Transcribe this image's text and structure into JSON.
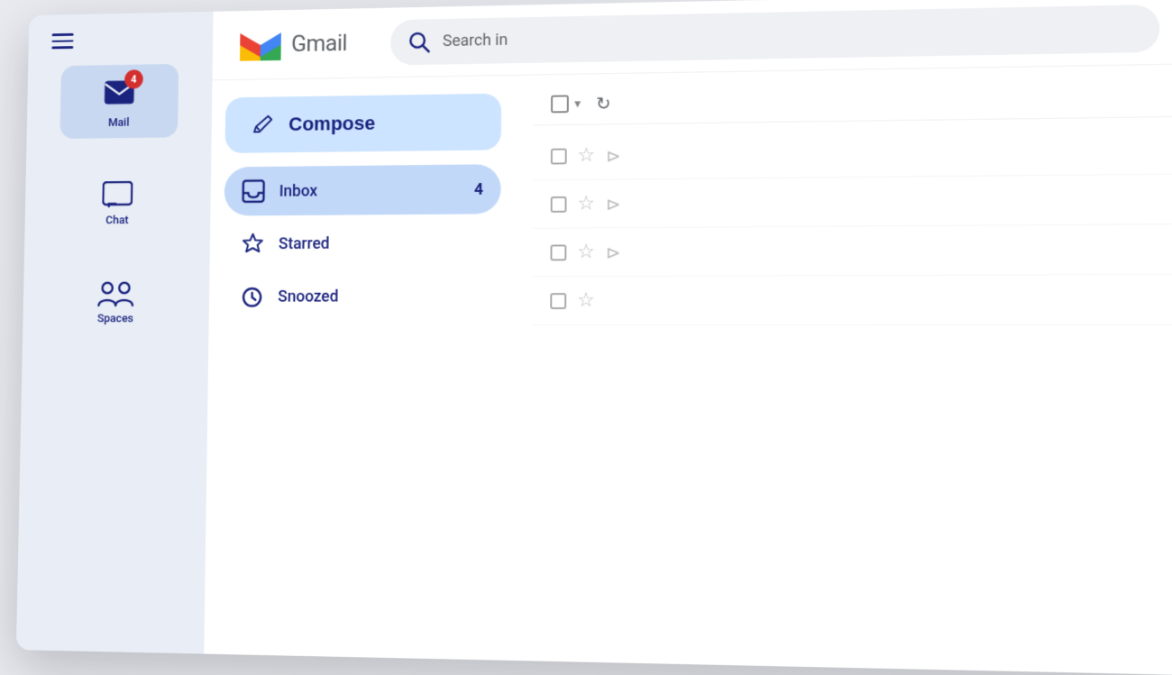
{
  "app": {
    "title": "Gmail",
    "search_placeholder": "Search in"
  },
  "sidebar": {
    "items": [
      {
        "label": "Mail",
        "badge": "4",
        "icon": "mail-icon"
      },
      {
        "label": "Chat",
        "icon": "chat-icon"
      },
      {
        "label": "Spaces",
        "icon": "people-icon"
      }
    ]
  },
  "compose": {
    "label": "Compose",
    "icon": "pencil-icon"
  },
  "nav": {
    "items": [
      {
        "label": "Inbox",
        "count": "4",
        "icon": "inbox-icon",
        "active": true
      },
      {
        "label": "Starred",
        "count": "",
        "icon": "star-icon",
        "active": false
      },
      {
        "label": "Snoozed",
        "count": "",
        "icon": "clock-icon",
        "active": false
      }
    ]
  },
  "toolbar": {
    "select_label": "Select",
    "refresh_label": "Refresh"
  },
  "email_rows": [
    {
      "id": 1
    },
    {
      "id": 2
    },
    {
      "id": 3
    },
    {
      "id": 4
    }
  ],
  "colors": {
    "compose_bg": "#cce4ff",
    "inbox_bg": "#c2d8f8",
    "sidebar_bg": "#e8edf6",
    "accent": "#1a237e",
    "badge_bg": "#d32f2f"
  }
}
